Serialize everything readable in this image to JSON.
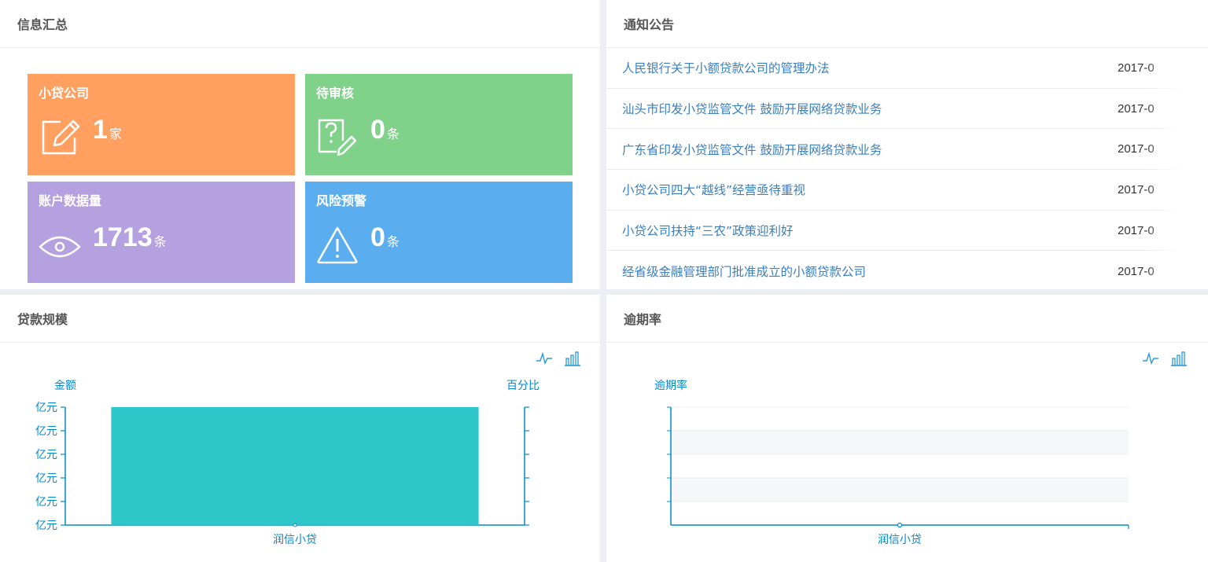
{
  "info": {
    "title": "信息汇总",
    "tiles": [
      {
        "title": "小贷公司",
        "value": "1",
        "unit": "家",
        "icon": "edit-icon",
        "color": "#ffa061"
      },
      {
        "title": "待审核",
        "value": "0",
        "unit": "条",
        "icon": "question-edit-icon",
        "color": "#80d18a"
      },
      {
        "title": "账户数据量",
        "value": "1713",
        "unit": "条",
        "icon": "eye-icon",
        "color": "#b5a1e0"
      },
      {
        "title": "风险预警",
        "value": "0",
        "unit": "条",
        "icon": "warning-icon",
        "color": "#5aaeef"
      }
    ]
  },
  "notice": {
    "title": "通知公告",
    "items": [
      {
        "title": "人民银行关于小额贷款公司的管理办法",
        "date": "2017-0"
      },
      {
        "title": "汕头市印发小贷监管文件 鼓励开展网络贷款业务",
        "date": "2017-0"
      },
      {
        "title": "广东省印发小贷监管文件 鼓励开展网络贷款业务",
        "date": "2017-0"
      },
      {
        "title": "小贷公司四大“越线”经营亟待重视",
        "date": "2017-0"
      },
      {
        "title": "小贷公司扶持“三农”政策迎利好",
        "date": "2017-0"
      },
      {
        "title": "经省级金融管理部门批准成立的小额贷款公司",
        "date": "2017-0"
      }
    ]
  },
  "loan": {
    "title": "贷款规模",
    "tools": [
      "line-chart-icon",
      "bar-chart-icon"
    ]
  },
  "overdue": {
    "title": "逾期率",
    "tools": [
      "line-chart-icon",
      "bar-chart-icon"
    ]
  },
  "chart_data": [
    {
      "type": "bar",
      "title": "",
      "categories": [
        "润信小贷"
      ],
      "ylabel": "金额",
      "y2label": "百分比",
      "y_tick_labels": [
        "亿元",
        "亿元",
        "亿元",
        "亿元",
        "亿元",
        "亿元"
      ],
      "series": [
        {
          "name": "",
          "values": [
            1
          ]
        }
      ],
      "ylim": [
        0,
        1
      ],
      "color": "#2ec7c9",
      "axis_color": "#008acd",
      "grid": false
    },
    {
      "type": "line",
      "title": "",
      "categories": [
        "润信小贷"
      ],
      "ylabel": "逾期率",
      "series": [
        {
          "name": "",
          "values": [
            0
          ]
        }
      ],
      "ylim": [
        0,
        1
      ],
      "axis_color": "#008acd",
      "grid": true
    }
  ]
}
